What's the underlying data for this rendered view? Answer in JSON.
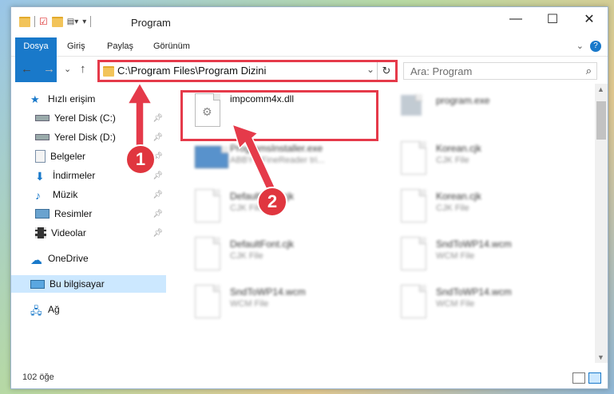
{
  "window": {
    "title": "Program",
    "controls": {
      "minimize": "—",
      "maximize": "☐",
      "close": "✕"
    }
  },
  "ribbon": {
    "tabs": [
      "Dosya",
      "Giriş",
      "Paylaş",
      "Görünüm"
    ]
  },
  "nav": {
    "back": "←",
    "forward": "→",
    "recent": "⌄",
    "up": "↑",
    "address": "C:\\Program Files\\Program Dizini",
    "search_placeholder": "Ara: Program"
  },
  "sidebar": {
    "items": [
      {
        "label": "Hızlı erişim",
        "icon": "star-icon"
      },
      {
        "label": "Yerel Disk (C:)",
        "icon": "drive-icon",
        "pinned": true
      },
      {
        "label": "Yerel Disk (D:)",
        "icon": "drive-icon",
        "pinned": true
      },
      {
        "label": "Belgeler",
        "icon": "documents-icon",
        "pinned": true
      },
      {
        "label": "İndirmeler",
        "icon": "download-icon",
        "pinned": true
      },
      {
        "label": "Müzik",
        "icon": "music-icon",
        "pinned": true
      },
      {
        "label": "Resimler",
        "icon": "pictures-icon",
        "pinned": true
      },
      {
        "label": "Videolar",
        "icon": "video-icon",
        "pinned": true
      },
      {
        "label": "OneDrive",
        "icon": "cloud-icon"
      },
      {
        "label": "Bu bilgisayar",
        "icon": "computer-icon",
        "selected": true
      },
      {
        "label": "Ağ",
        "icon": "network-icon"
      }
    ]
  },
  "files": [
    {
      "name": "impcomm4x.dll",
      "type": ""
    },
    {
      "name": "program.exe",
      "type": ""
    },
    {
      "name": "ProgramsInstaller.exe",
      "type": "ABBYY FineReader tri..."
    },
    {
      "name": "Korean.cjk",
      "type": "CJK File"
    },
    {
      "name": "DefaultFont.cjk",
      "type": "CJK File"
    },
    {
      "name": "Korean.cjk",
      "type": "CJK File"
    },
    {
      "name": "DefaultFont.cjk",
      "type": "CJK File"
    },
    {
      "name": "SndToWP14.wcm",
      "type": "WCM File"
    },
    {
      "name": "SndToWP14.wcm",
      "type": "WCM File"
    },
    {
      "name": "SndToWP14.wcm",
      "type": "WCM File"
    }
  ],
  "status": {
    "item_count": "102 öğe"
  },
  "callouts": [
    "1",
    "2"
  ],
  "colors": {
    "accent": "#1979ca",
    "highlight": "#e53a4a",
    "selected": "#cce8ff"
  }
}
